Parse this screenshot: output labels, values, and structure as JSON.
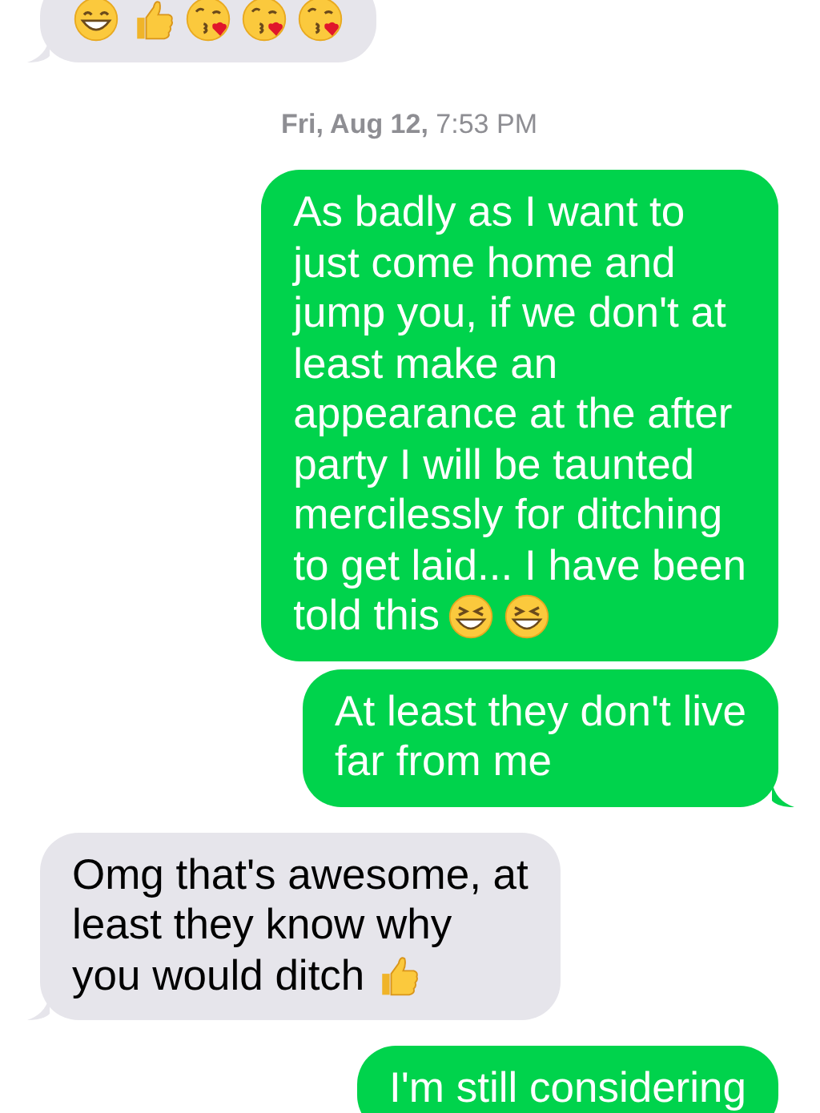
{
  "messages": [
    {
      "kind": "bubble",
      "sent": false,
      "emojis": [
        {
          "kind": "grin"
        },
        {
          "kind": "thumbs-up"
        },
        {
          "kind": "kiss"
        },
        {
          "kind": "kiss"
        },
        {
          "kind": "kiss"
        }
      ],
      "tail": true,
      "cut_top": true
    },
    {
      "kind": "timestamp",
      "text": "**Fri, Aug 12,** 7:53 PM"
    },
    {
      "kind": "bubble",
      "sent": true,
      "lines": [
        "As badly as I want to",
        "just come home and",
        "jump you, if we don't at",
        "least make an",
        "appearance at the after",
        "party I will be taunted",
        "mercilessly for ditching",
        "to get laid... I have been",
        "told this"
      ],
      "emojis": [
        {
          "kind": "laugh"
        },
        {
          "kind": "laugh"
        }
      ],
      "tail": false,
      "cut_top": false
    },
    {
      "kind": "bubble",
      "sent": true,
      "lines": [
        "At least they don't live",
        "far from me"
      ],
      "tail": true,
      "cut_top": false
    },
    {
      "kind": "bubble",
      "sent": false,
      "lines": [
        "Omg that's awesome, at",
        "least they know why",
        "you would ditch"
      ],
      "emojis": [
        {
          "kind": "thumbs-up"
        }
      ],
      "tail": true,
      "cut_top": false
    },
    {
      "kind": "bubble",
      "sent": true,
      "lines": [
        "I'm still considering"
      ],
      "tail": false,
      "cut_top": false
    }
  ]
}
